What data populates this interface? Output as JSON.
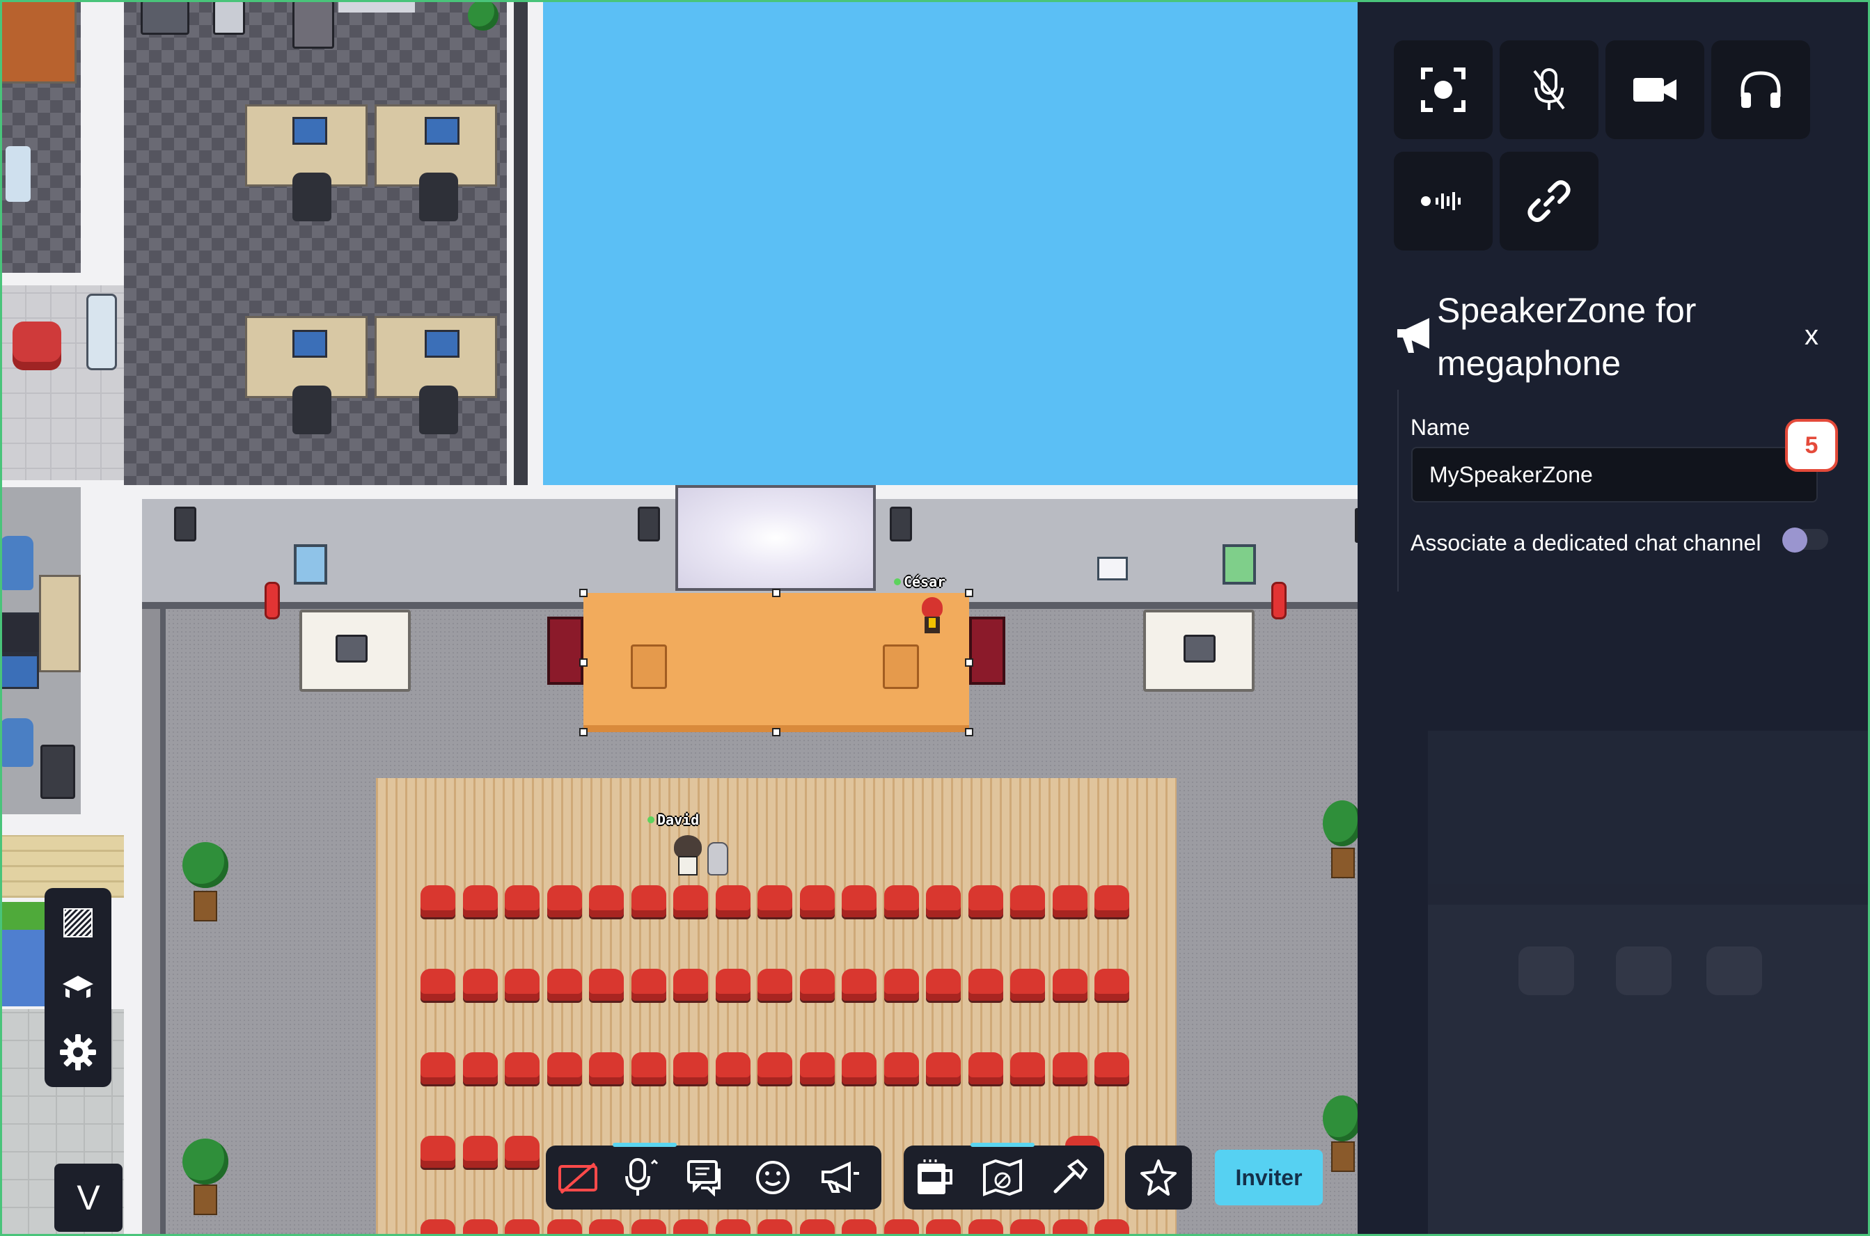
{
  "map": {
    "characters": [
      {
        "name": "César"
      },
      {
        "name": "David"
      }
    ]
  },
  "left_toolbar": {
    "items": [
      {
        "icon": "hatch-pattern-icon"
      },
      {
        "icon": "map-layer-icon"
      },
      {
        "icon": "gear-icon"
      }
    ],
    "v_label": "V"
  },
  "bottom_bar": {
    "left_group": [
      "camera-off-icon",
      "microphone-icon",
      "chat-icon",
      "emoji-icon",
      "megaphone-icon"
    ],
    "right_group": [
      "coffee-cup-icon",
      "world-map-icon",
      "hammer-icon"
    ],
    "star_icon": "star-icon",
    "invite_label": "Inviter"
  },
  "panel": {
    "buttons_row1": [
      "screen-share-icon",
      "mic-muted-icon",
      "video-camera-icon",
      "headphones-icon"
    ],
    "buttons_row2": [
      "audio-wave-icon",
      "link-icon"
    ],
    "zone_title": "SpeakerZone for megaphone",
    "close_label": "x",
    "name_label": "Name",
    "name_value": "MySpeakerZone",
    "badge_value": "5",
    "chat_label": "Associate a dedicated chat channel",
    "chat_enabled": false
  },
  "colors": {
    "sky": "#5bbff5",
    "panel_bg": "#1b2030",
    "accent": "#56d1f2",
    "badge": "#e44a3a",
    "stage": "#f2ab5c"
  }
}
